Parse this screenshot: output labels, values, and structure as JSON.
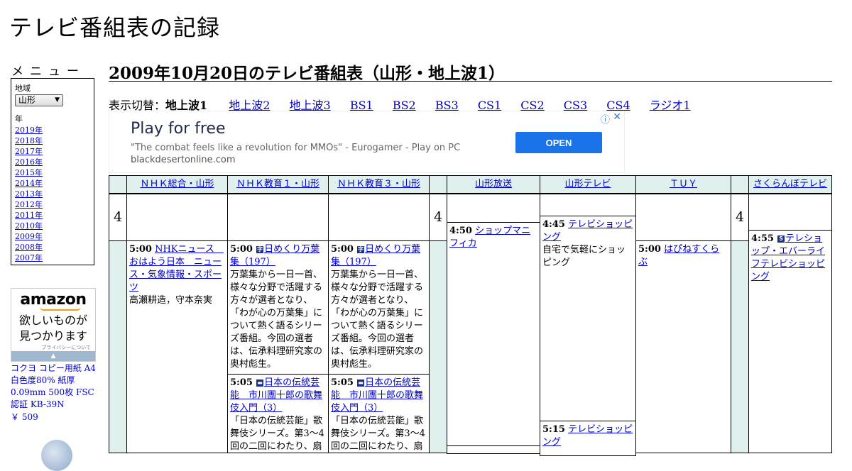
{
  "site_title": "テレビ番組表の記録",
  "sidebar": {
    "menu_heading": "メニュー",
    "region_label": "地域",
    "region_value": "山形",
    "year_label": "年",
    "years": [
      "2019年",
      "2018年",
      "2017年",
      "2016年",
      "2015年",
      "2014年",
      "2013年",
      "2012年",
      "2011年",
      "2010年",
      "2009年",
      "2008年",
      "2007年"
    ],
    "amazon_ad": {
      "logo": "amazon",
      "catch_line1": "欲しいものが",
      "catch_line2": "見つかります",
      "privacy": "プライバシーについて",
      "product": "コクヨ コピー用紙 A4 白色度80% 紙厚 0.09mm 500枚 FSC認証 KB-39N",
      "price": "￥ 509"
    }
  },
  "main": {
    "heading": "2009年10月20日のテレビ番組表（山形・地上波1）",
    "switcher_label": "表示切替：",
    "switcher_current": "地上波1",
    "switcher_links": [
      "地上波2",
      "地上波3",
      "BS1",
      "BS2",
      "BS3",
      "CS1",
      "CS2",
      "CS3",
      "CS4",
      "ラジオ1"
    ]
  },
  "ad_banner": {
    "title": "Play for free",
    "quote": "\"The combat feels like a revolution for MMOs\" - Eurogamer - Play on PC",
    "domain": "blackdesertonline.com",
    "button": "OPEN",
    "close": "✕",
    "info": "ⓘ"
  },
  "schedule": {
    "hour": "4",
    "channels": [
      "ＮＨＫ総合・山形",
      "ＮＨＫ教育１・山形",
      "ＮＨＫ教育３・山形",
      "山形放送",
      "山形テレビ",
      "ＴＵＹ",
      "さくらんぼテレビ"
    ],
    "programs": {
      "nhk_sogo_500": {
        "time": "5:00",
        "title": "NHKニュース　おはよう日本　ニュース・気象情報・スポーツ",
        "desc": "高瀬耕造，守本奈実"
      },
      "nhk_edu1_500": {
        "time": "5:00",
        "title": "日めくり万葉集（197）",
        "desc": "万葉集から一日一首、様々な分野で活躍する方々が選者となり、「わが心の万葉集」について熱く語るシリーズ番組。今回の選者は、伝承料理研究家の奥村彪生。"
      },
      "nhk_edu3_500": {
        "time": "5:00",
        "title": "日めくり万葉集（197）",
        "desc": "万葉集から一日一首、様々な分野で活躍する方々が選者となり、「わが心の万葉集」について熱く語るシリーズ番組。今回の選者は、伝承料理研究家の奥村彪生。"
      },
      "nhk_edu1_505": {
        "time": "5:05",
        "title": "日本の伝統芸能　市川團十郎の歌舞伎入門（3）",
        "desc": "「日本の伝統芸能」歌舞伎シリーズ。第3～4回の二回にわたり、扇"
      },
      "nhk_edu3_505": {
        "time": "5:05",
        "title": "日本の伝統芸能　市川團十郎の歌舞伎入門（3）",
        "desc": "「日本の伝統芸能」歌舞伎シリーズ。第3～4回の二回にわたり、扇"
      },
      "ybc_450": {
        "time": "4:50",
        "title": "ショップマニフィカ"
      },
      "yts_445": {
        "time": "4:45",
        "title": "テレビショッピング",
        "desc": "自宅で気軽にショッピング"
      },
      "yts_515": {
        "time": "5:15",
        "title": "テレビショッピング"
      },
      "tuy_500": {
        "time": "5:00",
        "title": "はぴねすくらぶ"
      },
      "sat_455": {
        "time": "4:55",
        "title": "テレショップ・エバーライフテレビショッピング"
      }
    },
    "icons": {
      "ji": "字",
      "tv": "▬",
      "s": "S"
    }
  }
}
